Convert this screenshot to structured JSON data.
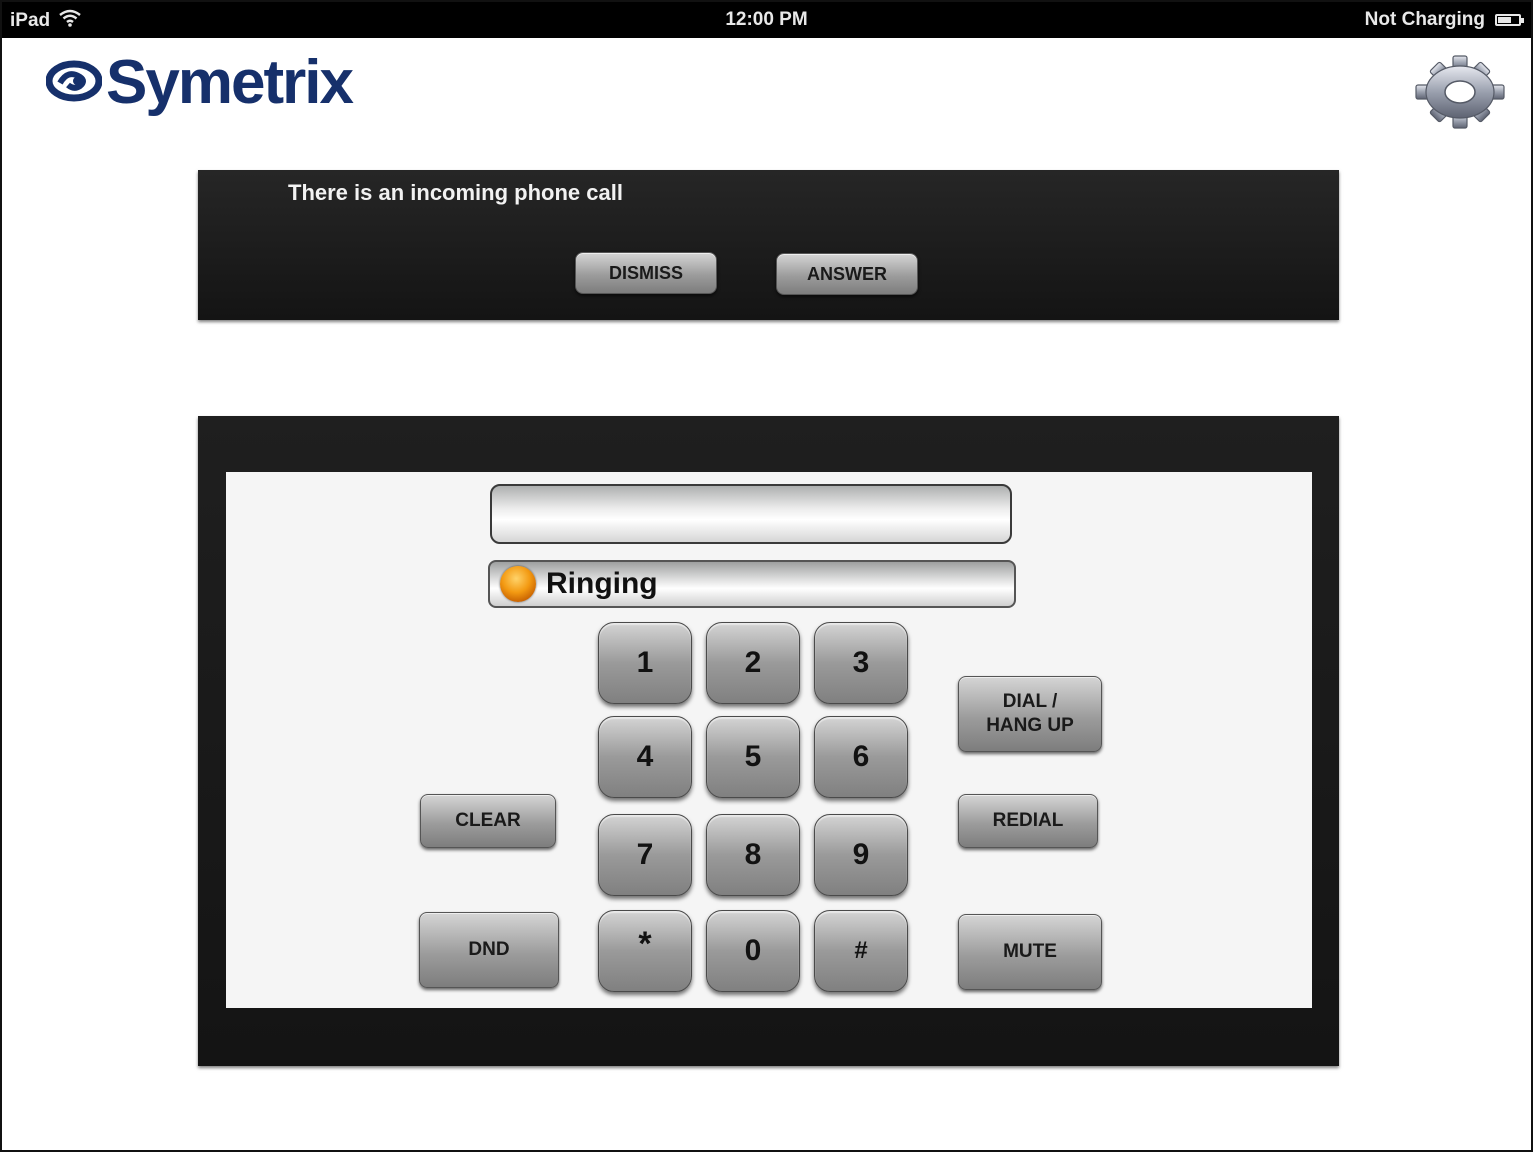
{
  "status_bar": {
    "device": "iPad",
    "time": "12:00 PM",
    "battery_status": "Not Charging",
    "icons": [
      "wifi-icon",
      "battery-icon"
    ]
  },
  "header": {
    "logo_text": "Symetrix",
    "brand_color": "#16306b",
    "settings_icon": "gear-icon"
  },
  "notification": {
    "message": "There is an incoming phone call",
    "dismiss_label": "DISMISS",
    "answer_label": "ANSWER"
  },
  "phone": {
    "dial_value": "",
    "call_status": "Ringing",
    "status_led_color": "#f39a12",
    "keys": [
      "1",
      "2",
      "3",
      "4",
      "5",
      "6",
      "7",
      "8",
      "9",
      "*",
      "0",
      "#"
    ],
    "clear_label": "CLEAR",
    "dnd_label": "DND",
    "dial_hangup_label_line1": "DIAL /",
    "dial_hangup_label_line2": "HANG UP",
    "redial_label": "REDIAL",
    "mute_label": "MUTE"
  }
}
